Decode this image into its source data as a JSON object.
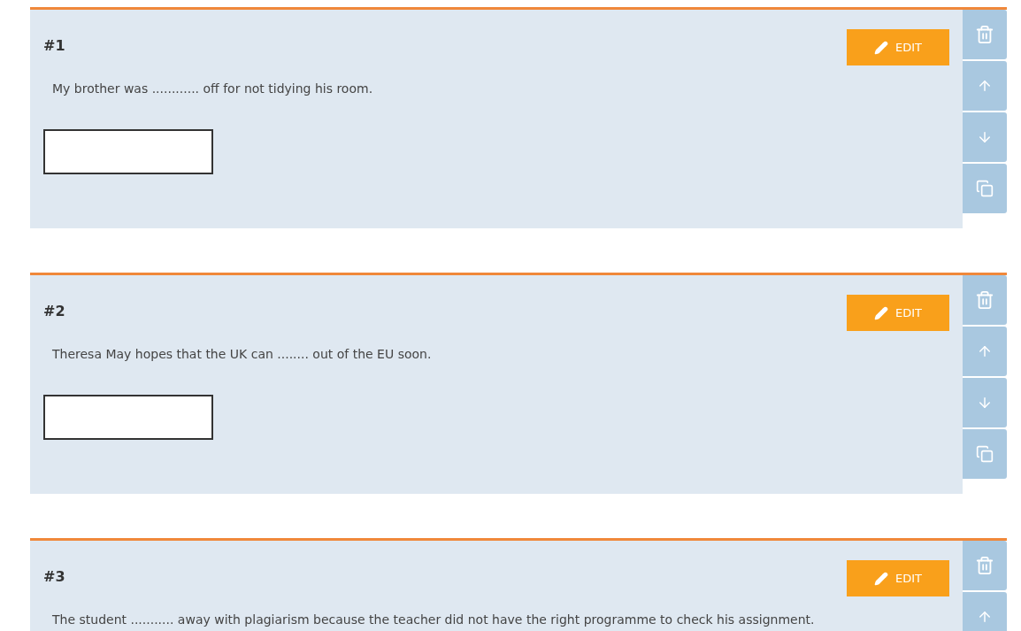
{
  "questions": [
    {
      "number": "#1",
      "text": "My brother was ............ off for not tidying his room.",
      "edit_label": "EDIT"
    },
    {
      "number": "#2",
      "text": "Theresa May hopes that the UK can ........ out of the EU soon.",
      "edit_label": "EDIT"
    },
    {
      "number": "#3",
      "text": "The student ........... away with plagiarism because the teacher did not have the right programme to check his assignment.",
      "edit_label": "EDIT"
    }
  ]
}
